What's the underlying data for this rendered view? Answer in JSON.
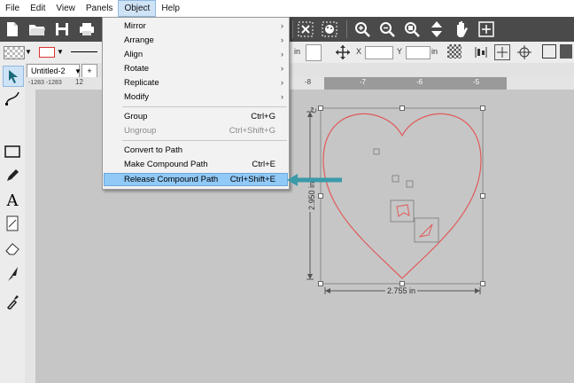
{
  "menubar": {
    "items": [
      "File",
      "Edit",
      "View",
      "Panels",
      "Object",
      "Help"
    ],
    "active": "Object"
  },
  "toolbar2": {
    "x_label": "X",
    "y_label": "Y",
    "x_unit": "in",
    "y_unit": "in",
    "partial_unit": "in"
  },
  "tabs": {
    "document": "Untitled-2",
    "add": "+"
  },
  "ruler": {
    "ticks": [
      "-8",
      "-7",
      "-6",
      "-5",
      "12"
    ],
    "coords": "-1283 -1283"
  },
  "object_menu": {
    "items": [
      {
        "label": "Mirror",
        "submenu": true
      },
      {
        "label": "Arrange",
        "submenu": true
      },
      {
        "label": "Align",
        "submenu": true
      },
      {
        "label": "Rotate",
        "submenu": true
      },
      {
        "label": "Replicate",
        "submenu": true
      },
      {
        "label": "Modify",
        "submenu": true
      },
      {
        "label": "Group",
        "shortcut": "Ctrl+G"
      },
      {
        "label": "Ungroup",
        "shortcut": "Ctrl+Shift+G",
        "disabled": true
      },
      {
        "label": "Convert to Path"
      },
      {
        "label": "Make Compound Path",
        "shortcut": "Ctrl+E"
      },
      {
        "label": "Release Compound Path",
        "shortcut": "Ctrl+Shift+E",
        "highlighted": true
      }
    ]
  },
  "selection": {
    "width_label": "2.755 in",
    "height_label": "2.950 in"
  },
  "colors": {
    "heart_stroke": "#e05a5a",
    "arrow": "#3a9aa8",
    "highlight": "#91c9f7",
    "toolbar_dark": "#4a4a4a"
  }
}
